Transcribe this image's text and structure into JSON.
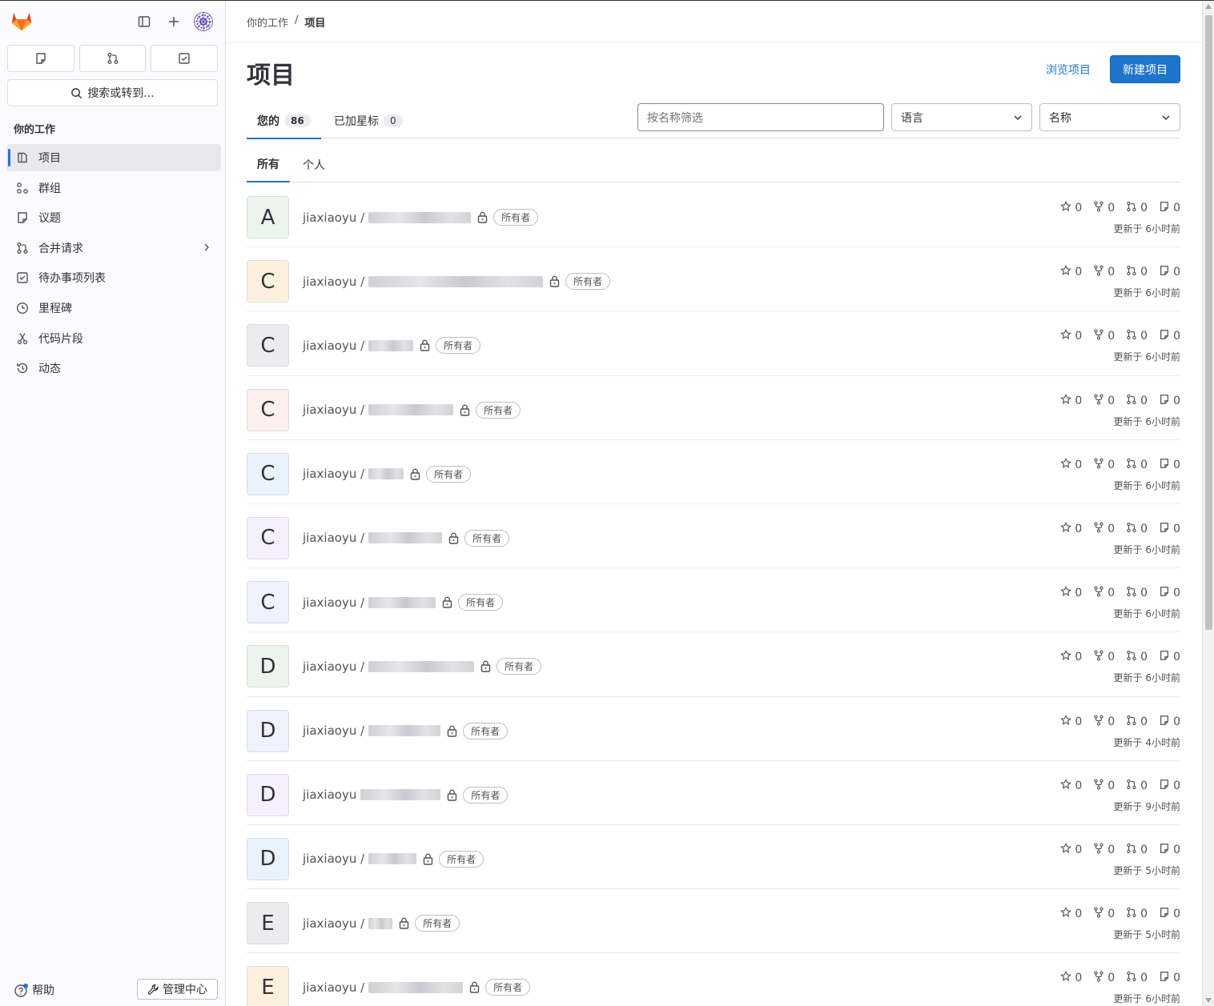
{
  "sidebar": {
    "search_label": "搜索或转到...",
    "section_title": "你的工作",
    "items": [
      {
        "label": "项目",
        "icon": "project-icon",
        "active": true
      },
      {
        "label": "群组",
        "icon": "group-icon"
      },
      {
        "label": "议题",
        "icon": "issues-icon"
      },
      {
        "label": "合并请求",
        "icon": "merge-request-icon",
        "chevron": true
      },
      {
        "label": "待办事项列表",
        "icon": "todo-icon"
      },
      {
        "label": "里程碑",
        "icon": "milestone-icon"
      },
      {
        "label": "代码片段",
        "icon": "snippet-icon"
      },
      {
        "label": "动态",
        "icon": "history-icon"
      }
    ],
    "help_label": "帮助",
    "admin_label": "管理中心"
  },
  "breadcrumb": {
    "parent": "你的工作",
    "current": "项目"
  },
  "header": {
    "title": "项目",
    "browse_label": "浏览项目",
    "new_label": "新建项目"
  },
  "tabs": {
    "yours_label": "您的",
    "yours_count": "86",
    "starred_label": "已加星标",
    "starred_count": "0"
  },
  "filter": {
    "placeholder": "按名称筛选",
    "language_label": "语言",
    "sort_label": "名称"
  },
  "subtabs": {
    "all_label": "所有",
    "personal_label": "个人"
  },
  "owner_badge": "所有者",
  "projects": [
    {
      "letter": "A",
      "namespace": "jiaxiaoyu /",
      "stars": "0",
      "forks": "0",
      "mrs": "0",
      "issues": "0",
      "updated": "更新于 6小时前",
      "bg": "#ecf4ee"
    },
    {
      "letter": "C",
      "namespace": "jiaxiaoyu /",
      "stars": "0",
      "forks": "0",
      "mrs": "0",
      "issues": "0",
      "updated": "更新于 6小时前",
      "bg": "#fdf1dd"
    },
    {
      "letter": "C",
      "namespace": "jiaxiaoyu /",
      "stars": "0",
      "forks": "0",
      "mrs": "0",
      "issues": "0",
      "updated": "更新于 6小时前",
      "bg": "#ececef"
    },
    {
      "letter": "C",
      "namespace": "jiaxiaoyu /",
      "stars": "0",
      "forks": "0",
      "mrs": "0",
      "issues": "0",
      "updated": "更新于 6小时前",
      "bg": "#fcf1ef"
    },
    {
      "letter": "C",
      "namespace": "jiaxiaoyu /",
      "stars": "0",
      "forks": "0",
      "mrs": "0",
      "issues": "0",
      "updated": "更新于 6小时前",
      "bg": "#e9f3fc"
    },
    {
      "letter": "C",
      "namespace": "jiaxiaoyu /",
      "stars": "0",
      "forks": "0",
      "mrs": "0",
      "issues": "0",
      "updated": "更新于 6小时前",
      "bg": "#f4f0ff"
    },
    {
      "letter": "C",
      "namespace": "jiaxiaoyu /",
      "stars": "0",
      "forks": "0",
      "mrs": "0",
      "issues": "0",
      "updated": "更新于 6小时前",
      "bg": "#f1f1ff"
    },
    {
      "letter": "D",
      "namespace": "jiaxiaoyu /",
      "stars": "0",
      "forks": "0",
      "mrs": "0",
      "issues": "0",
      "updated": "更新于 6小时前",
      "bg": "#ecf4ee"
    },
    {
      "letter": "D",
      "namespace": "jiaxiaoyu /",
      "stars": "0",
      "forks": "0",
      "mrs": "0",
      "issues": "0",
      "updated": "更新于 4小时前",
      "bg": "#f1f1ff"
    },
    {
      "letter": "D",
      "namespace": "jiaxiaoyu",
      "stars": "0",
      "forks": "0",
      "mrs": "0",
      "issues": "0",
      "updated": "更新于 9小时前",
      "bg": "#f4f0ff"
    },
    {
      "letter": "D",
      "namespace": "jiaxiaoyu /",
      "stars": "0",
      "forks": "0",
      "mrs": "0",
      "issues": "0",
      "updated": "更新于 5小时前",
      "bg": "#e9f3fc"
    },
    {
      "letter": "E",
      "namespace": "jiaxiaoyu /",
      "stars": "0",
      "forks": "0",
      "mrs": "0",
      "issues": "0",
      "updated": "更新于 5小时前",
      "bg": "#ececef"
    },
    {
      "letter": "E",
      "namespace": "jiaxiaoyu /",
      "stars": "0",
      "forks": "0",
      "mrs": "0",
      "issues": "0",
      "updated": "更新于 6小时前",
      "bg": "#fdf1dd"
    }
  ]
}
